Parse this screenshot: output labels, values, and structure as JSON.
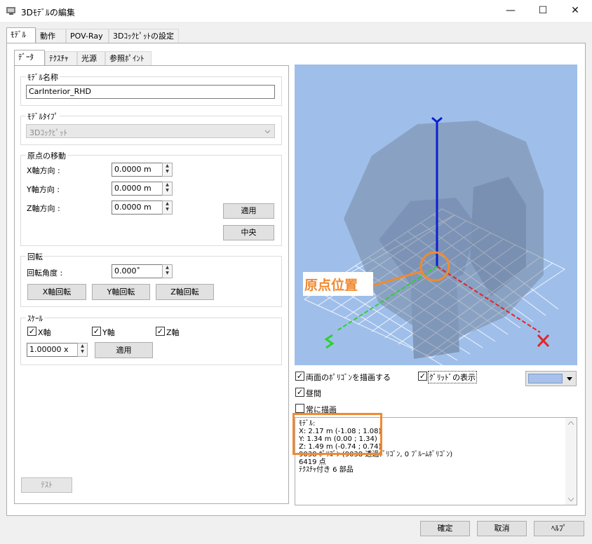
{
  "window": {
    "title": "3Dﾓﾃﾞﾙの編集",
    "minimize": "—",
    "maximize": "☐",
    "close": "✕"
  },
  "main_tabs": [
    "ﾓﾃﾞﾙ",
    "動作",
    "POV-Ray",
    "3Dｺｯｸﾋﾟｯﾄの設定"
  ],
  "sub_tabs": [
    "ﾃﾞｰﾀ",
    "ﾃｸｽﾁｬ",
    "光源",
    "参照ﾎﾟｲﾝﾄ"
  ],
  "model_name": {
    "label": "ﾓﾃﾞﾙ名称",
    "value": "CarInterior_RHD"
  },
  "model_type": {
    "label": "ﾓﾃﾞﾙﾀｲﾌﾟ",
    "value": "3Dｺｯｸﾋﾟｯﾄ"
  },
  "origin": {
    "label": "原点の移動",
    "x_label": "X軸方向 :",
    "x_value": "0.0000 m",
    "y_label": "Y軸方向 :",
    "y_value": "0.0000 m",
    "z_label": "Z軸方向 :",
    "z_value": "0.0000 m",
    "apply": "適用",
    "center": "中央"
  },
  "rotation": {
    "label": "回転",
    "angle_label": "回転角度 :",
    "angle_value": "0.000˚",
    "x_button": "X軸回転",
    "y_button": "Y軸回転",
    "z_button": "Z軸回転"
  },
  "scale": {
    "label": "ｽｹｰﾙ",
    "x_check": "X軸",
    "y_check": "Y軸",
    "z_check": "Z軸",
    "value": "1.00000 x",
    "apply": "適用"
  },
  "test_button": "ﾃｽﾄ",
  "viewport": {
    "origin_annotation": "原点位置",
    "background_color": "#9fbfea",
    "annotation_color": "#f08a30"
  },
  "options": {
    "double_sided": "両面のﾎﾟﾘｺﾞﾝを描画する",
    "show_grid": "ｸﾞﾘｯﾄﾞの表示",
    "daytime": "昼間",
    "always_draw": "常に描画",
    "color_swatch": "#a7c1ea"
  },
  "info_lines": [
    "ﾓﾃﾞﾙ:",
    "X: 2.17 m (-1.08 ; 1.08)",
    "Y: 1.34 m (0.00 ; 1.34)",
    "Z: 1.49 m (-0.74 ; 0.74)",
    "9038 ﾎﾟﾘｺﾞﾝ (9038 透過ﾎﾟﾘｺﾞﾝ, 0 ﾌﾞﾙｰﾑﾎﾟﾘｺﾞﾝ)",
    "6419 点",
    "ﾃｸｽﾁｬ付き 6 部品"
  ],
  "footer": {
    "ok": "確定",
    "cancel": "取消",
    "help": "ﾍﾙﾌﾟ"
  }
}
